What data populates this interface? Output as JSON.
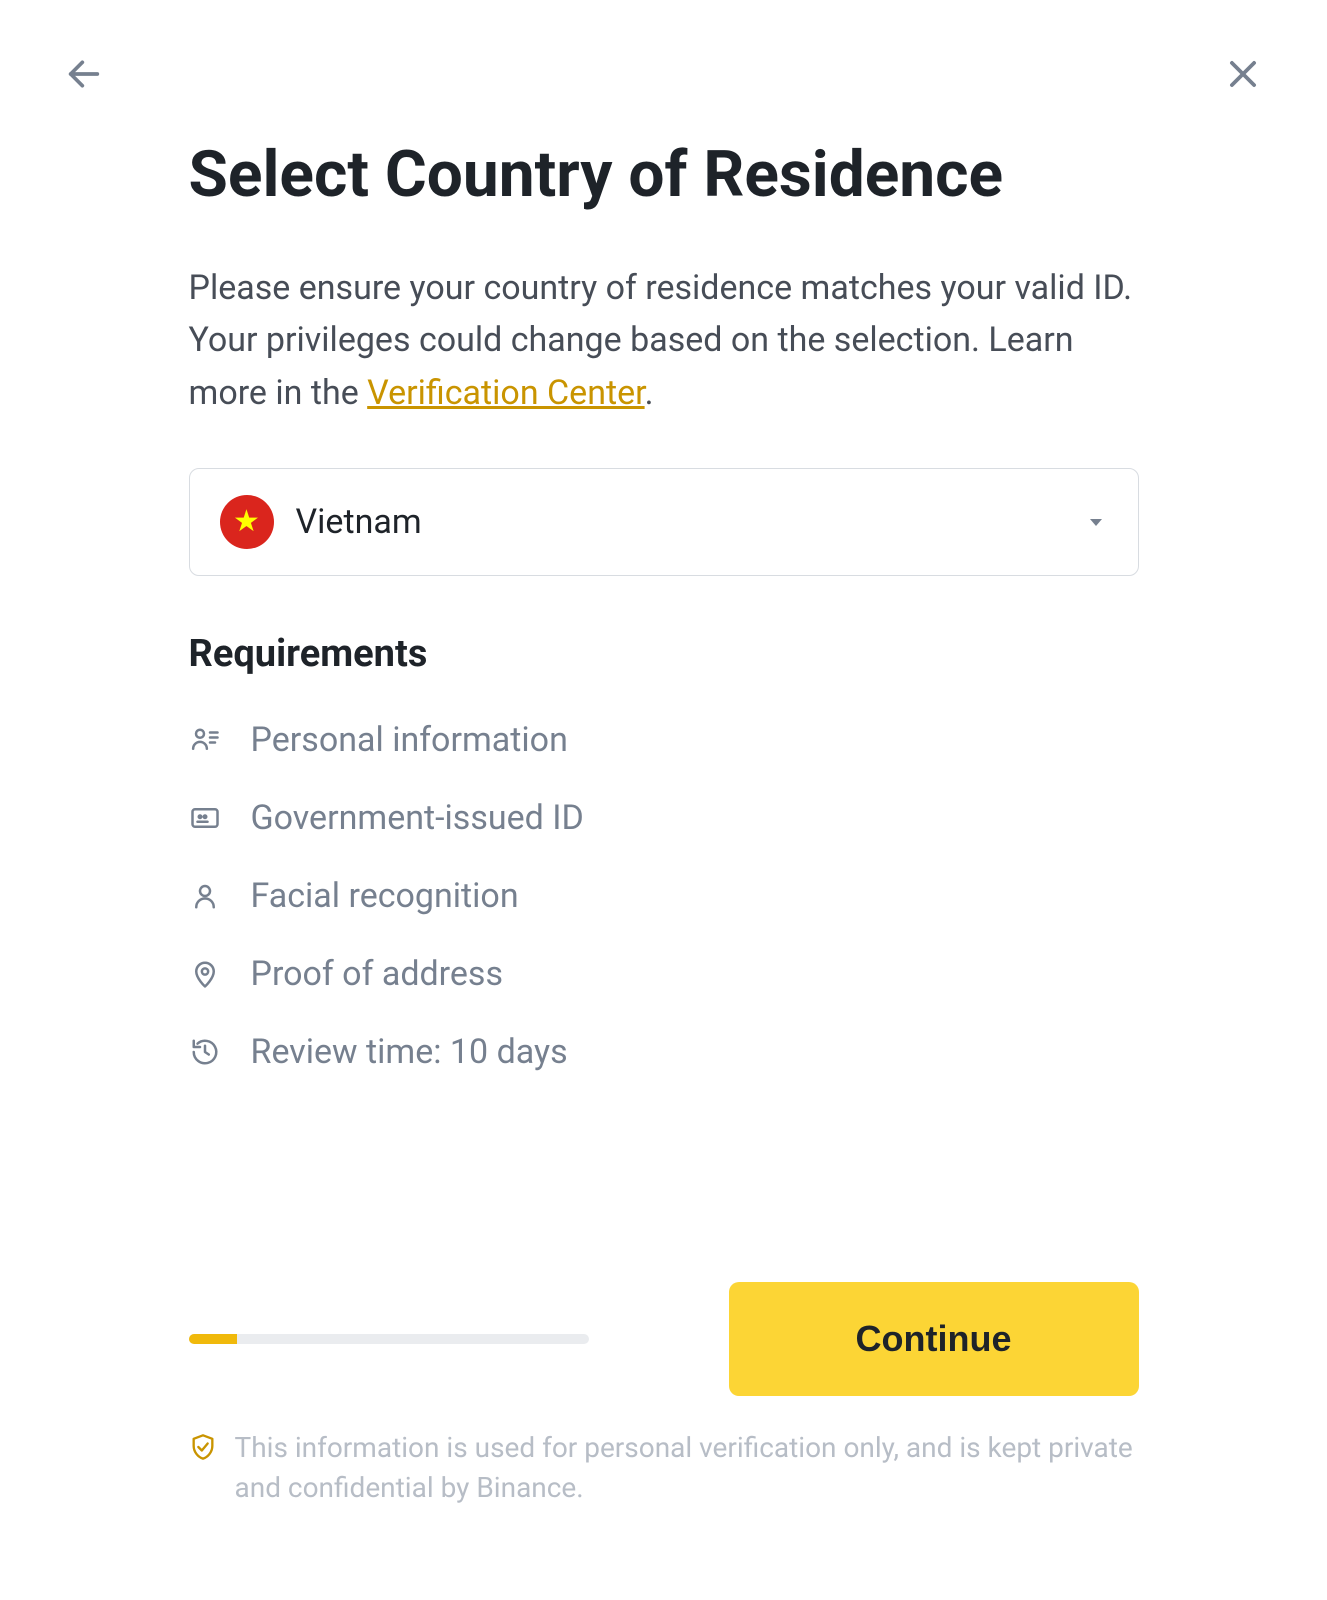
{
  "page": {
    "title": "Select Country of Residence",
    "description_prefix": "Please ensure your country of residence matches your valid ID. Your privileges could change based on the selection. Learn more in the ",
    "link_text": "Verification Center",
    "description_suffix": "."
  },
  "select": {
    "value": "Vietnam",
    "flag_color": "#da251d"
  },
  "requirements": {
    "heading": "Requirements",
    "items": [
      {
        "icon": "person-info-icon",
        "label": "Personal information"
      },
      {
        "icon": "id-card-icon",
        "label": "Government-issued ID"
      },
      {
        "icon": "face-icon",
        "label": "Facial recognition"
      },
      {
        "icon": "pin-icon",
        "label": "Proof of address"
      },
      {
        "icon": "clock-icon",
        "label": "Review time: 10 days"
      }
    ]
  },
  "progress": {
    "percent": 12
  },
  "actions": {
    "continue": "Continue"
  },
  "disclaimer": "This information is used for personal verification only, and is kept private and confidential by Binance."
}
